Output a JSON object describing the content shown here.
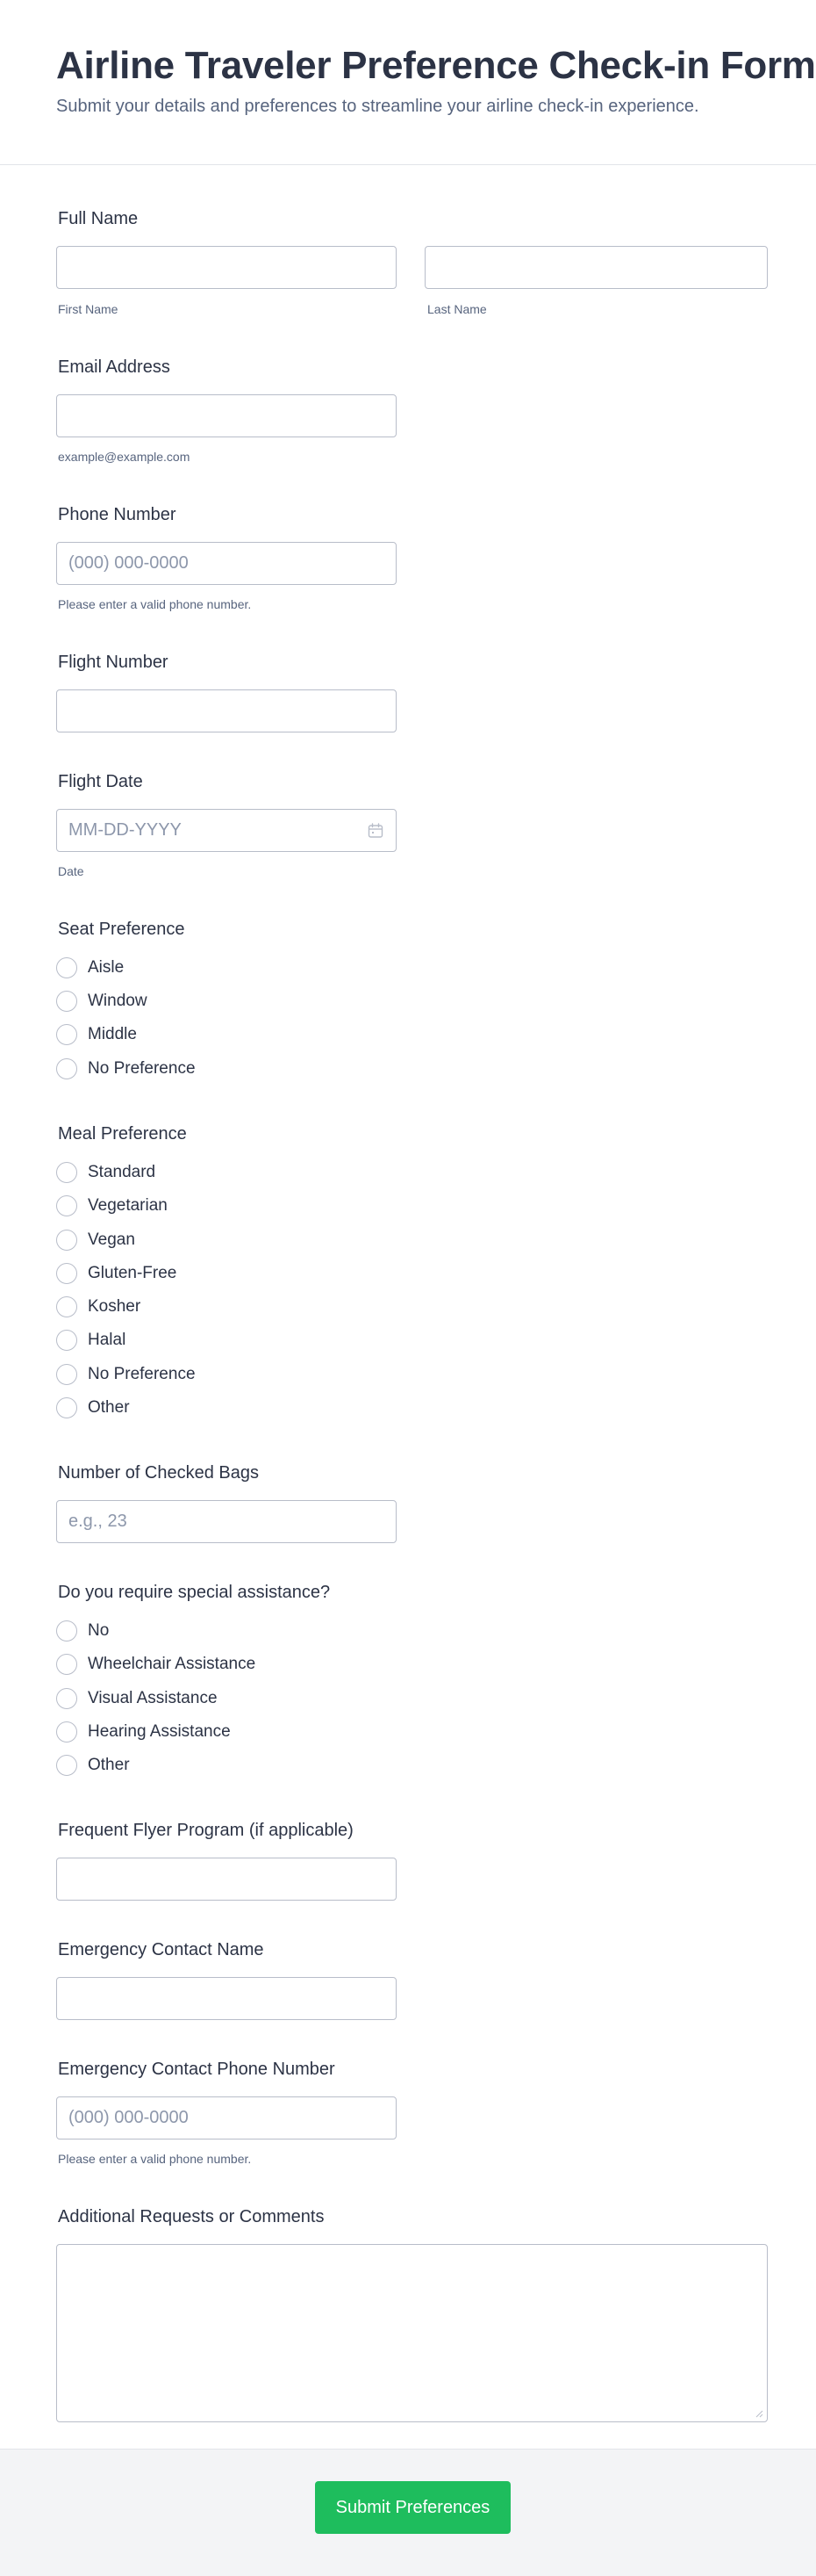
{
  "header": {
    "title": "Airline Traveler Preference Check-in Form",
    "subtitle": "Submit your details and preferences to streamline your airline check-in experience."
  },
  "full_name": {
    "label": "Full Name",
    "first_value": "",
    "last_value": "",
    "first_sublabel": "First Name",
    "last_sublabel": "Last Name"
  },
  "email": {
    "label": "Email Address",
    "value": "",
    "sublabel": "example@example.com"
  },
  "phone": {
    "label": "Phone Number",
    "placeholder": "(000) 000-0000",
    "sublabel": "Please enter a valid phone number."
  },
  "flight_number": {
    "label": "Flight Number",
    "value": ""
  },
  "flight_date": {
    "label": "Flight Date",
    "placeholder": "MM-DD-YYYY",
    "sublabel": "Date",
    "icon": "calendar-icon"
  },
  "seat_preference": {
    "label": "Seat Preference",
    "options": [
      "Aisle",
      "Window",
      "Middle",
      "No Preference"
    ]
  },
  "meal_preference": {
    "label": "Meal Preference",
    "options": [
      "Standard",
      "Vegetarian",
      "Vegan",
      "Gluten-Free",
      "Kosher",
      "Halal",
      "No Preference",
      "Other"
    ]
  },
  "checked_bags": {
    "label": "Number of Checked Bags",
    "placeholder": "e.g., 23"
  },
  "special_assistance": {
    "label": "Do you require special assistance?",
    "options": [
      "No",
      "Wheelchair Assistance",
      "Visual Assistance",
      "Hearing Assistance",
      "Other"
    ]
  },
  "frequent_flyer": {
    "label": "Frequent Flyer Program (if applicable)",
    "value": ""
  },
  "emergency_name": {
    "label": "Emergency Contact Name",
    "value": ""
  },
  "emergency_phone": {
    "label": "Emergency Contact Phone Number",
    "placeholder": "(000) 000-0000",
    "sublabel": "Please enter a valid phone number."
  },
  "comments": {
    "label": "Additional Requests or Comments",
    "value": ""
  },
  "footer": {
    "submit_label": "Submit Preferences"
  },
  "colors": {
    "submit": "#1ebd5d",
    "text": "#2c3345",
    "sublabel": "#57647e",
    "border": "#b8bdc9"
  }
}
